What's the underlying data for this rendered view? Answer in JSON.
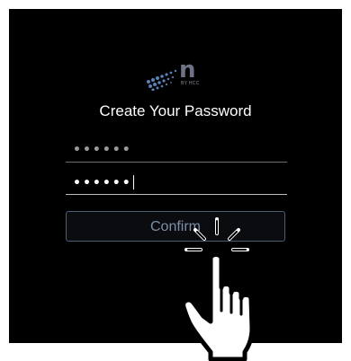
{
  "screen": {
    "title": "Create Your Password",
    "logo": {
      "letter": "n",
      "subtitle": "BY HCC"
    },
    "password_field": {
      "value": "••••••",
      "masked": true
    },
    "confirm_password_field": {
      "value": "••••••",
      "masked": true,
      "focused": true
    },
    "confirm_button": {
      "label": "Confirm"
    }
  },
  "overlay": {
    "icon": "tap-hand-icon"
  }
}
